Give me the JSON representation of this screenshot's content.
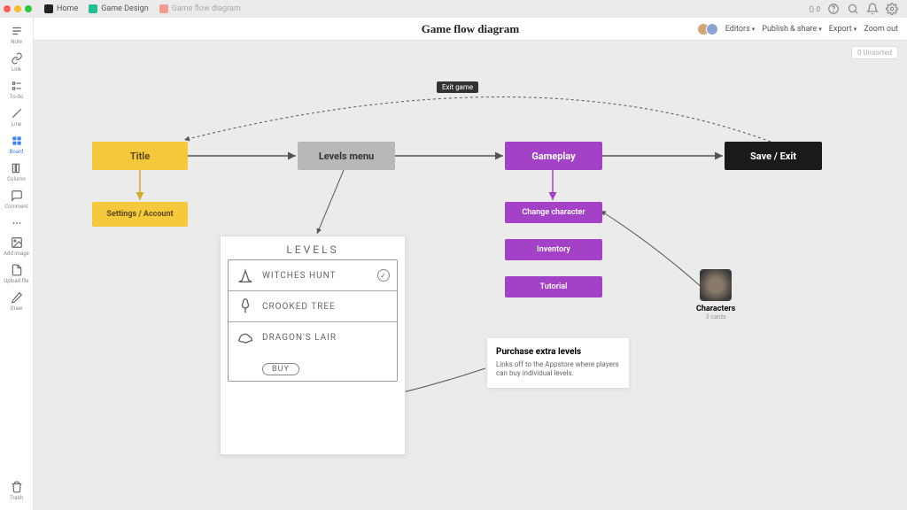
{
  "tabs": {
    "home": "Home",
    "design": "Game Design",
    "diagram": "Game flow diagram"
  },
  "topbar": {
    "count": "0"
  },
  "header": {
    "title": "Game flow diagram",
    "editors": "Editors",
    "publish": "Publish & share",
    "export": "Export",
    "zoom": "Zoom out"
  },
  "unsorted": {
    "count": "0",
    "label": "Unsorted"
  },
  "tools": {
    "note": "Note",
    "link": "Link",
    "todo": "To-do",
    "line": "Line",
    "board": "Board",
    "column": "Column",
    "comment": "Comment",
    "addimage": "Add image",
    "upload": "Upload file",
    "draw": "Draw",
    "trash": "Trash"
  },
  "nodes": {
    "title": "Title",
    "settings": "Settings / Account",
    "levels": "Levels menu",
    "gameplay": "Gameplay",
    "change_char": "Change character",
    "inventory": "Inventory",
    "tutorial": "Tutorial",
    "save_exit": "Save / Exit",
    "exit_game": "Exit game"
  },
  "sketch": {
    "title": "LEVELS",
    "row1": "WITCHES HUNT",
    "row2": "CROOKED TREE",
    "row3": "DRAGON'S LAIR",
    "buy": "BUY"
  },
  "note": {
    "title": "Purchase extra levels",
    "body": "Links off to the Appstore where players can buy individual levels."
  },
  "characters": {
    "title": "Characters",
    "sub": "3 cards"
  }
}
